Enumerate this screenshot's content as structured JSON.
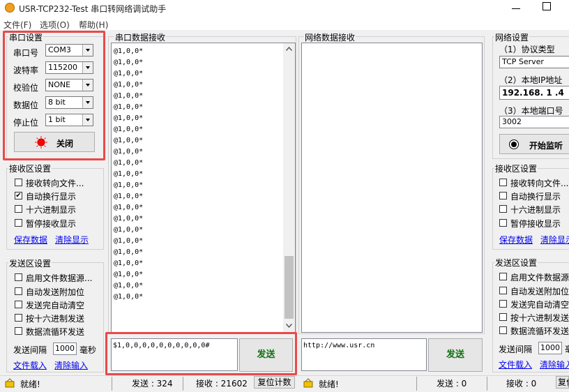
{
  "window": {
    "title": "USR-TCP232-Test 串口转网络调试助手"
  },
  "menu": {
    "file": "文件(F)",
    "options": "选项(O)",
    "help": "帮助(H)"
  },
  "serial_settings": {
    "title": "串口设置",
    "port_label": "串口号",
    "port_value": "COM3",
    "baud_label": "波特率",
    "baud_value": "115200",
    "parity_label": "校验位",
    "parity_value": "NONE",
    "databits_label": "数据位",
    "databits_value": "8 bit",
    "stopbits_label": "停止位",
    "stopbits_value": "1 bit",
    "close_button": "关闭"
  },
  "left_rx_settings": {
    "title": "接收区设置",
    "redirect_file": "接收转向文件...",
    "auto_newline": "自动换行显示",
    "hex_display": "十六进制显示",
    "pause_display": "暂停接收显示",
    "save_data": "保存数据",
    "clear_display": "清除显示"
  },
  "left_tx_settings": {
    "title": "发送区设置",
    "file_source": "启用文件数据源...",
    "auto_append": "自动发送附加位",
    "clear_after_send": "发送完自动清空",
    "hex_send": "按十六进制发送",
    "loop_send": "数据流循环发送",
    "interval_label": "发送间隔",
    "interval_value": "1000",
    "interval_unit": "毫秒",
    "load_file": "文件载入",
    "clear_input": "清除输入"
  },
  "serial_rx": {
    "title": "串口数据接收",
    "lines": [
      "@1,0,0*",
      "@1,0,0*",
      "@1,0,0*",
      "@1,0,0*",
      "@1,0,0*",
      "@1,0,0*",
      "@1,0,0*",
      "@1,0,0*",
      "@1,0,0*",
      "@1,0,0*",
      "@1,0,0*",
      "@1,0,0*",
      "@1,0,0*",
      "@1,0,0*",
      "@1,0,0*",
      "@1,0,0*",
      "@1,0,0*",
      "@1,0,0*",
      "@1,0,0*",
      "@1,0,0*",
      "@1,0,0*",
      "@1,0,0*",
      "@1,0,0*"
    ]
  },
  "serial_tx": {
    "input_value": "$1,0,0,0,0,0,0,0,0,0,0#",
    "send_button": "发送"
  },
  "net_rx": {
    "title": "网络数据接收"
  },
  "net_tx": {
    "input_value": "http://www.usr.cn",
    "send_button": "发送"
  },
  "net_settings": {
    "title": "网络设置",
    "protocol_label": "（1）协议类型",
    "protocol_value": "TCP Server",
    "local_ip_label": "（2）本地IP地址",
    "local_ip_value": "192.168. 1 .4",
    "local_port_label": "（3）本地端口号",
    "local_port_value": "3002",
    "start_button": "开始监听"
  },
  "right_rx_settings": {
    "title": "接收区设置",
    "redirect_file": "接收转向文件...",
    "auto_newline": "自动换行显示",
    "hex_display": "十六进制显示",
    "pause_display": "暂停接收显示",
    "save_data": "保存数据",
    "clear_display": "清除显示"
  },
  "right_tx_settings": {
    "title": "发送区设置",
    "file_source": "启用文件数据源...",
    "auto_append": "自动发送附加位",
    "clear_after_send": "发送完自动清空",
    "hex_send": "按十六进制发送",
    "loop_send": "数据流循环发送",
    "interval_label": "发送间隔",
    "interval_value": "1000",
    "interval_unit": "毫秒",
    "load_file": "文件载入",
    "clear_input": "清除输入"
  },
  "status_left": {
    "ready": "就绪!",
    "sent": "发送 : 324",
    "received": "接收 : 21602",
    "reset": "复位计数"
  },
  "status_right": {
    "ready": "就绪!",
    "sent": "发送 : 0",
    "received": "接收 : 0",
    "reset": "复位计数"
  },
  "colors": {
    "highlight": "#e84a4a",
    "panel": "#f0f0f0",
    "link": "#0000ee",
    "indicator": "#ff0000"
  }
}
